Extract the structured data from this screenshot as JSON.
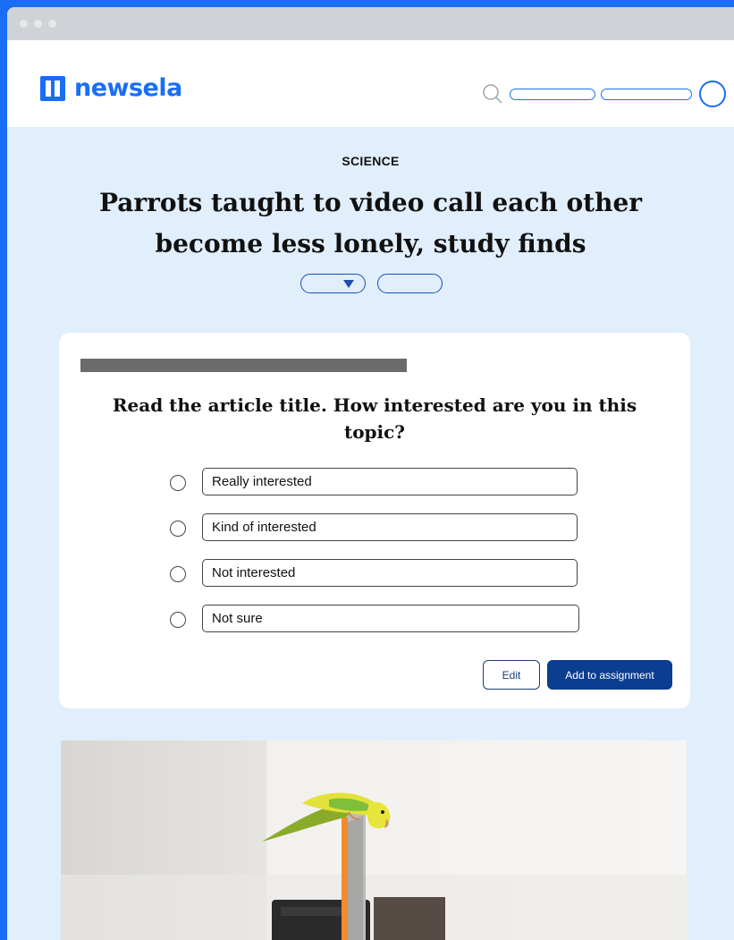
{
  "brand": {
    "name": "newsela",
    "color": "#1a6ef5"
  },
  "header": {
    "search_icon": "search-icon",
    "profile_icon": "profile-circle-icon"
  },
  "article": {
    "category": "SCIENCE",
    "title": "Parrots taught to video call each other become less lonely, study finds",
    "image_alt": "Yellow and green parakeet perched on top of a tablet"
  },
  "question_card": {
    "prompt": "Read the article title. How interested are you in this topic?",
    "options": [
      {
        "label": "Really interested",
        "selected": false
      },
      {
        "label": "Kind of interested",
        "selected": false
      },
      {
        "label": "Not interested",
        "selected": false
      },
      {
        "label": "Not sure",
        "selected": false
      }
    ],
    "edit_label": "Edit",
    "add_label": "Add to assignment"
  },
  "colors": {
    "page_bg": "#e1eefc",
    "frame": "#1a6ef5",
    "primary_button": "#0b3d91"
  }
}
